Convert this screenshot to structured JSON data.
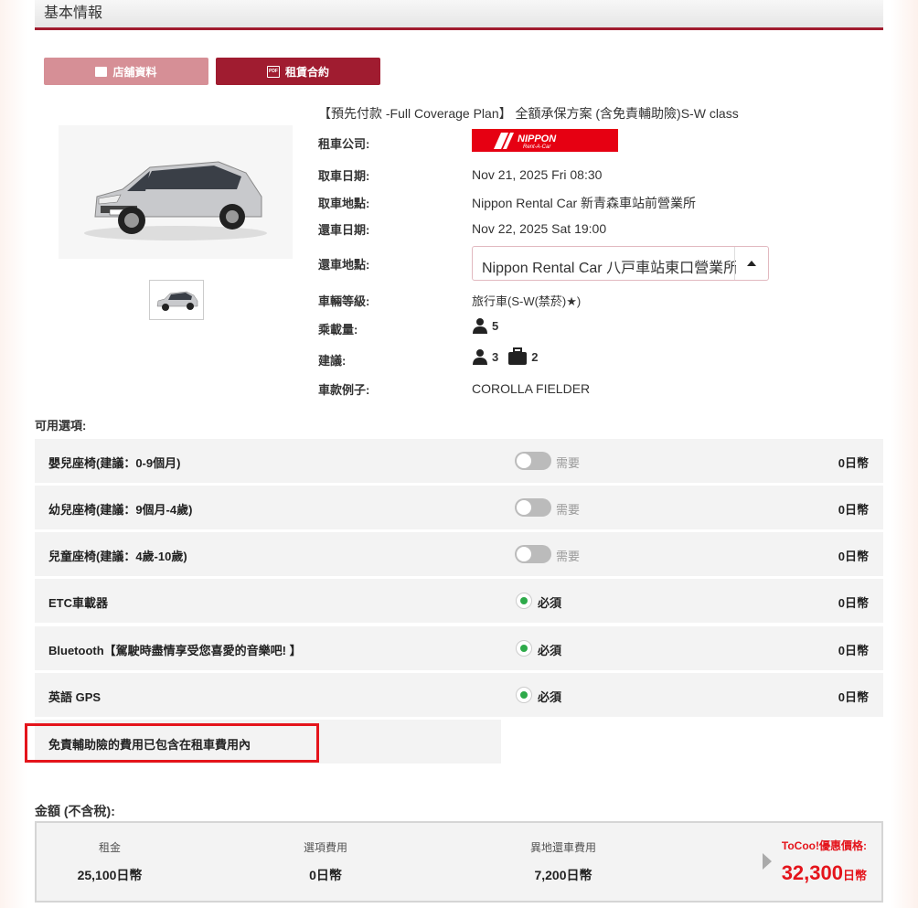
{
  "section": {
    "title": "基本情報"
  },
  "buttons": {
    "store_info": "店舖資料",
    "rental_contract": "租賃合約"
  },
  "plan": {
    "title": "【預先付款 -Full Coverage Plan】 全額承保方案 (含免責輔助險)S-W class"
  },
  "details": {
    "company_label": "租車公司:",
    "company_logo_text": "NIPPON",
    "company_logo_sub": "Rent-A-Car",
    "pickup_date_label": "取車日期:",
    "pickup_date": "Nov 21, 2025 Fri 08:30",
    "pickup_location_label": "取車地點:",
    "pickup_location": "Nippon Rental Car 新青森車站前營業所",
    "return_date_label": "還車日期:",
    "return_date": "Nov 22, 2025 Sat 19:00",
    "return_location_label": "還車地點:",
    "return_location": "Nippon Rental Car 八戸車站東口營業所",
    "vehicle_class_label": "車輛等級:",
    "vehicle_class": "旅行車(S-W(禁菸)★)",
    "capacity_label": "乘載量:",
    "capacity": "5",
    "recommend_label": "建議:",
    "recommend_persons": "3",
    "recommend_bags": "2",
    "model_label": "車款例子:",
    "model": "COROLLA FIELDER"
  },
  "options": {
    "title": "可用選項:",
    "items": [
      {
        "name": "嬰兒座椅(建議：0-9個月)",
        "state": "需要",
        "price": "0日幣"
      },
      {
        "name": "幼兒座椅(建議：9個月-4歲)",
        "state": "需要",
        "price": "0日幣"
      },
      {
        "name": "兒童座椅(建議：4歲-10歲)",
        "state": "需要",
        "price": "0日幣"
      },
      {
        "name": "ETC車載器",
        "state": "必須",
        "price": "0日幣"
      },
      {
        "name": "Bluetooth【駕駛時盡情享受您喜愛的音樂吧! 】",
        "state": "必須",
        "price": "0日幣"
      },
      {
        "name": "英語 GPS",
        "state": "必須",
        "price": "0日幣"
      }
    ],
    "insurance_note": "免責輔助險的費用已包含在租車費用內"
  },
  "amount": {
    "title": "金額 (不含稅):",
    "rent_label": "租金",
    "rent_value": "25,100日幣",
    "option_label": "選項費用",
    "option_value": "0日幣",
    "dropoff_label": "異地還車費用",
    "dropoff_value": "7,200日幣",
    "promo_label": "ToCoo!優惠價格:",
    "promo_value": "32,300",
    "promo_unit": "日幣"
  },
  "colors": {
    "accent": "#a01c30",
    "brand_red": "#e60012",
    "promo": "#e4141b",
    "check_green": "#2eaa4a"
  }
}
